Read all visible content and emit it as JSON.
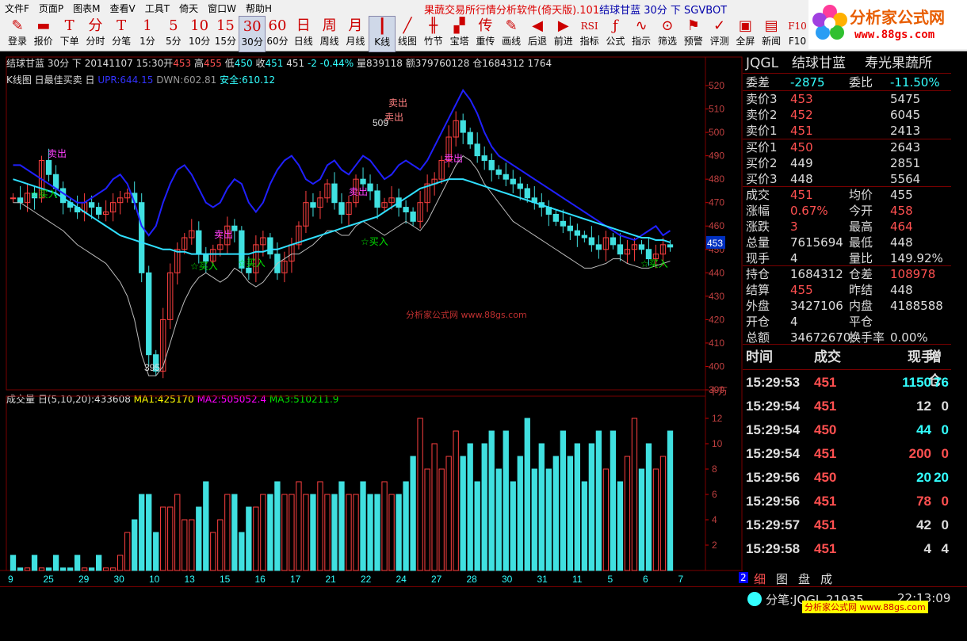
{
  "menu": {
    "items": [
      "文件F",
      "页面P",
      "图表M",
      "查看V",
      "工具T",
      "倚天",
      "窗口W",
      "帮助H"
    ],
    "app_title": "果蔬交易所行情分析软件(倚天版).101",
    "app_title_suffix": "结球甘蓝 30分 下 SGVBOT"
  },
  "toolbar": [
    {
      "icon": "✎",
      "label": "登录"
    },
    {
      "icon": "▬",
      "label": "报价"
    },
    {
      "icon": "T",
      "label": "下单"
    },
    {
      "icon": "分",
      "label": "分时"
    },
    {
      "icon": "T",
      "label": "分笔"
    },
    {
      "icon": "1",
      "label": "1分"
    },
    {
      "icon": "5",
      "label": "5分"
    },
    {
      "icon": "10",
      "label": "10分"
    },
    {
      "icon": "15",
      "label": "15分"
    },
    {
      "icon": "30",
      "label": "30分"
    },
    {
      "icon": "60",
      "label": "60分"
    },
    {
      "icon": "日",
      "label": "日线"
    },
    {
      "icon": "周",
      "label": "周线"
    },
    {
      "icon": "月",
      "label": "月线"
    },
    {
      "icon": "┃",
      "label": "K线"
    },
    {
      "icon": "╱",
      "label": "线图"
    },
    {
      "icon": "╫",
      "label": "竹节"
    },
    {
      "icon": "▞",
      "label": "宝塔"
    },
    {
      "icon": "传",
      "label": "重传"
    },
    {
      "icon": "✎",
      "label": "画线"
    },
    {
      "icon": "◀",
      "label": "后退"
    },
    {
      "icon": "▶",
      "label": "前进"
    },
    {
      "icon": "RSI",
      "label": "指标"
    },
    {
      "icon": "ƒ",
      "label": "公式"
    },
    {
      "icon": "∿",
      "label": "指示"
    },
    {
      "icon": "⊙",
      "label": "筛选"
    },
    {
      "icon": "⚑",
      "label": "预警"
    },
    {
      "icon": "✓",
      "label": "评测"
    },
    {
      "icon": "▣",
      "label": "全屏"
    },
    {
      "icon": "▤",
      "label": "新闻"
    },
    {
      "icon": "F10",
      "label": "F10"
    }
  ],
  "logo": {
    "title": "分析家公式网",
    "url": "www.88gs.com"
  },
  "info_line": {
    "name": "结球甘蓝 30分 下",
    "date": "20141107 15:30",
    "open_label": "开",
    "open": "453",
    "high_label": "高",
    "high": "455",
    "low_label": "低",
    "low": "450",
    "close_label": "收",
    "close": "451",
    "last": "451",
    "change": "-2",
    "change_pct": "-0.44%",
    "volume_label": "量",
    "volume": "839118",
    "amount_label": "额",
    "amount": "379760128",
    "position_label": "仓",
    "position": "1684312",
    "extra": "1764"
  },
  "indicator_line": {
    "name": "K线图 日最佳买卖 日",
    "upr": "UPR:644.15",
    "dwn": "DWN:602.81",
    "safe": "安全:610.12"
  },
  "volume_line": {
    "name": "成交量 日(5,10,20)",
    "val": ":433608",
    "ma1": "MA1:425170",
    "ma2": "MA2:505052.4",
    "ma3": "MA3:510211.9"
  },
  "chart_data": {
    "type": "candlestick",
    "price_axis": {
      "min": 390,
      "max": 520,
      "ticks": [
        520,
        510,
        500,
        490,
        480,
        470,
        460,
        450,
        440,
        430,
        420,
        410,
        400,
        390
      ],
      "current": "453"
    },
    "volume_axis": {
      "unit": "十万",
      "ticks": [
        12,
        10,
        8,
        6,
        4,
        2
      ]
    },
    "x_labels": [
      "9",
      "25",
      "29",
      "30",
      "10",
      "13",
      "15",
      "16",
      "17",
      "21",
      "22",
      "24",
      "27",
      "28",
      "30",
      "31",
      "11",
      "5",
      "6",
      "7"
    ],
    "annotations": [
      {
        "text": "卖出",
        "color": "#ff40ff"
      },
      {
        "text": "卖出",
        "color": "#ff8080"
      },
      {
        "text": "卖出",
        "color": "#ff8080"
      },
      {
        "text": "卖出",
        "color": "#ff40ff"
      },
      {
        "text": "☆买入",
        "color": "#00e000"
      },
      {
        "text": "☆买入",
        "color": "#00e000"
      },
      {
        "text": "☆买入",
        "color": "#00e000"
      },
      {
        "text": "☆买入",
        "color": "#00e000"
      },
      {
        "text": "☆买入",
        "color": "#00e000"
      },
      {
        "text": "卖出",
        "color": "#ff40ff"
      },
      {
        "text": "卖出",
        "color": "#ff40ff"
      }
    ],
    "labels": {
      "low": "395",
      "high": "509",
      "watermark": "分析家公式网 www.88gs.com"
    },
    "closes": [
      472,
      470,
      474,
      472,
      488,
      482,
      476,
      470,
      468,
      466,
      470,
      468,
      465,
      466,
      470,
      472,
      474,
      470,
      440,
      405,
      398,
      420,
      440,
      450,
      455,
      458,
      448,
      445,
      450,
      452,
      460,
      458,
      442,
      440,
      452,
      455,
      448,
      440,
      445,
      452,
      460,
      470,
      468,
      472,
      478,
      470,
      465,
      470,
      480,
      478,
      475,
      468,
      470,
      472,
      468,
      466,
      462,
      470,
      478,
      480,
      488,
      498,
      505,
      500,
      495,
      490,
      488,
      484,
      482,
      480,
      478,
      476,
      472,
      470,
      468,
      465,
      462,
      460,
      458,
      456,
      455,
      452,
      450,
      455,
      452,
      448,
      450,
      452,
      450,
      446,
      448,
      452,
      451
    ],
    "upr": [
      486,
      486,
      484,
      482,
      480,
      478,
      476,
      474,
      472,
      470,
      470,
      472,
      474,
      476,
      480,
      482,
      478,
      470,
      460,
      456,
      460,
      470,
      478,
      484,
      486,
      482,
      476,
      470,
      468,
      470,
      476,
      480,
      478,
      470,
      466,
      470,
      478,
      484,
      488,
      490,
      486,
      480,
      478,
      480,
      486,
      488,
      484,
      482,
      486,
      490,
      488,
      484,
      480,
      482,
      486,
      488,
      486,
      484,
      488,
      494,
      500,
      506,
      512,
      518,
      514,
      508,
      500,
      494,
      490,
      488,
      486,
      484,
      482,
      480,
      478,
      476,
      474,
      472,
      470,
      468,
      466,
      464,
      462,
      460,
      458,
      456,
      455,
      454,
      456,
      458,
      460,
      456,
      458
    ],
    "dwn": [
      470,
      470,
      468,
      466,
      464,
      462,
      460,
      458,
      455,
      452,
      450,
      448,
      446,
      444,
      440,
      436,
      430,
      420,
      405,
      396,
      396,
      400,
      410,
      420,
      428,
      434,
      438,
      440,
      438,
      436,
      438,
      442,
      440,
      436,
      434,
      436,
      440,
      444,
      446,
      448,
      448,
      450,
      452,
      455,
      458,
      458,
      456,
      456,
      460,
      462,
      460,
      458,
      456,
      458,
      460,
      462,
      460,
      458,
      462,
      468,
      474,
      480,
      486,
      490,
      488,
      484,
      478,
      474,
      470,
      466,
      462,
      460,
      458,
      456,
      454,
      452,
      450,
      448,
      446,
      444,
      442,
      442,
      443,
      444,
      446,
      446,
      444,
      443,
      442,
      442,
      443,
      444,
      445
    ],
    "safe": [
      480,
      479,
      478,
      477,
      476,
      475,
      474,
      472,
      470,
      468,
      466,
      464,
      462,
      460,
      458,
      456,
      455,
      454,
      453,
      452,
      451,
      450,
      450,
      449,
      449,
      448,
      448,
      448,
      448,
      448,
      448,
      448,
      448,
      448,
      449,
      449,
      450,
      450,
      451,
      452,
      453,
      454,
      455,
      456,
      457,
      458,
      459,
      460,
      461,
      462,
      463,
      464,
      466,
      468,
      470,
      472,
      474,
      476,
      477,
      478,
      479,
      480,
      480,
      480,
      479,
      478,
      477,
      476,
      475,
      474,
      473,
      472,
      471,
      470,
      469,
      468,
      467,
      466,
      465,
      464,
      463,
      462,
      461,
      460,
      459,
      458,
      457,
      456,
      455,
      455,
      454,
      454,
      453
    ]
  },
  "right_panel": {
    "header": {
      "code": "JQGL",
      "name": "结球甘蓝",
      "market": "寿光果蔬所"
    },
    "weibi": {
      "l1": "委差",
      "v1": "-2875",
      "l2": "委比",
      "v2": "-11.50%"
    },
    "asks": [
      {
        "l": "卖价3",
        "p": "453",
        "q": "5475"
      },
      {
        "l": "卖价2",
        "p": "452",
        "q": "6045"
      },
      {
        "l": "卖价1",
        "p": "451",
        "q": "2413"
      }
    ],
    "bids": [
      {
        "l": "买价1",
        "p": "450",
        "q": "2643"
      },
      {
        "l": "买价2",
        "p": "449",
        "q": "2851"
      },
      {
        "l": "买价3",
        "p": "448",
        "q": "5564"
      }
    ],
    "stats": [
      {
        "l1": "成交",
        "v1": "451",
        "l2": "均价",
        "v2": "455"
      },
      {
        "l1": "涨幅",
        "v1": "0.67%",
        "l2": "今开",
        "v2": "458"
      },
      {
        "l1": "涨跌",
        "v1": "3",
        "l2": "最高",
        "v2": "464"
      },
      {
        "l1": "总量",
        "v1": "7615694",
        "l2": "最低",
        "v2": "448"
      },
      {
        "l1": "现手",
        "v1": "4",
        "l2": "量比",
        "v2": "149.92%"
      }
    ],
    "stats2": [
      {
        "l1": "持仓",
        "v1": "1684312",
        "l2": "仓差",
        "v2": "108978"
      },
      {
        "l1": "结算",
        "v1": "455",
        "l2": "昨结",
        "v2": "448"
      },
      {
        "l1": "外盘",
        "v1": "3427106",
        "l2": "内盘",
        "v2": "4188588"
      },
      {
        "l1": "开仓",
        "v1": "4",
        "l2": "平仓",
        "v2": ""
      },
      {
        "l1": "总额",
        "v1": "34672670:",
        "l2": "换手率",
        "v2": "0.00%"
      }
    ],
    "ticks_header": {
      "time": "时间",
      "price": "成交",
      "vol": "现手",
      "pos": "增仓"
    },
    "ticks": [
      {
        "time": "15:29:53",
        "price": "451",
        "vol": "1150",
        "pos": "76",
        "color": "#ff5050",
        "vcolor": "#3ff"
      },
      {
        "time": "15:29:54",
        "price": "451",
        "vol": "12",
        "pos": "0",
        "color": "#ff5050",
        "vcolor": "#ddd"
      },
      {
        "time": "15:29:54",
        "price": "450",
        "vol": "44",
        "pos": "0",
        "color": "#ff5050",
        "vcolor": "#3ff"
      },
      {
        "time": "15:29:54",
        "price": "451",
        "vol": "200",
        "pos": "0",
        "color": "#ff5050",
        "vcolor": "#ff5050"
      },
      {
        "time": "15:29:56",
        "price": "450",
        "vol": "20",
        "pos": "20",
        "color": "#ff5050",
        "vcolor": "#3ff"
      },
      {
        "time": "15:29:56",
        "price": "451",
        "vol": "78",
        "pos": "0",
        "color": "#ff5050",
        "vcolor": "#ff5050"
      },
      {
        "time": "15:29:57",
        "price": "451",
        "vol": "42",
        "pos": "0",
        "color": "#ff5050",
        "vcolor": "#ddd"
      },
      {
        "time": "15:29:58",
        "price": "451",
        "vol": "4",
        "pos": "4",
        "color": "#ff5050",
        "vcolor": "#ddd"
      }
    ],
    "tabs": [
      "细",
      "图",
      "盘",
      "成"
    ],
    "page_num": "2"
  },
  "status": {
    "feed": "分笔:JQGL 21935",
    "time": "22:13:09",
    "watermark": "分析家公式网 www.88gs.com"
  },
  "colors": {
    "up": "#ff4040",
    "down": "#40e0e0",
    "upr": "#2020ff",
    "safe": "#30e0ff",
    "dwn": "#bbbbbb",
    "border": "#7a0000"
  }
}
